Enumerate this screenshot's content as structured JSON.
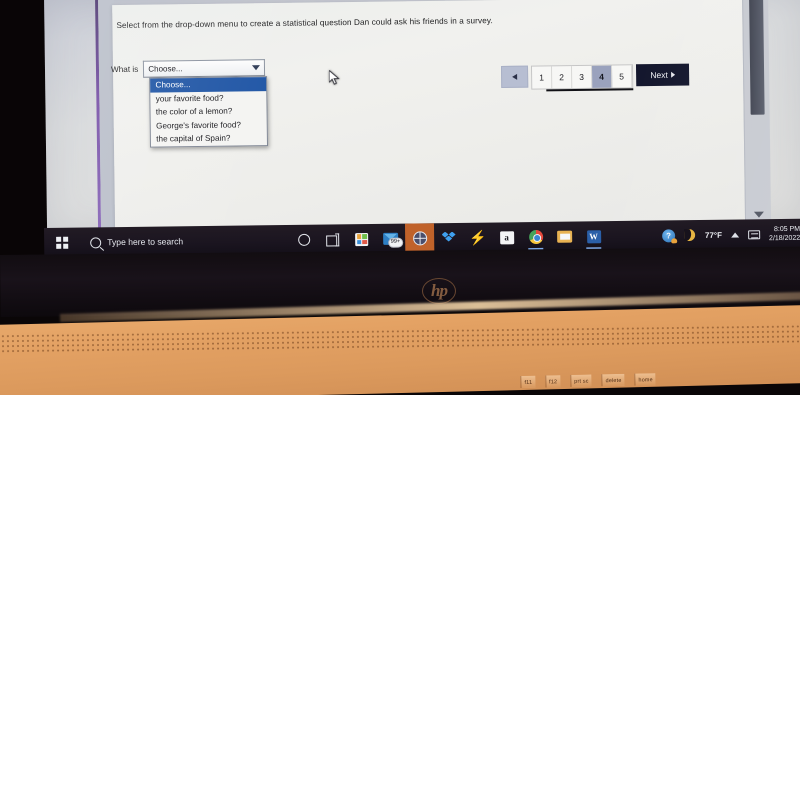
{
  "photo": {
    "device_brand_logo": "hp",
    "keyboard_keys": [
      "f11",
      "f12",
      "prt sc",
      "delete",
      "home"
    ]
  },
  "quiz": {
    "prompt": "Select from the drop-down menu to create a statistical question Dan could ask his friends in a survey.",
    "question_label": "What is",
    "dropdown": {
      "name": "statistical-question-select",
      "selected_value": "Choose...",
      "placeholder": "Choose...",
      "expanded": true,
      "highlighted_index": 0,
      "options": [
        "Choose...",
        "your favorite food?",
        "the color of a lemon?",
        "George's favorite food?",
        "the capital of Spain?"
      ]
    },
    "pagination": {
      "prev_label": "◂",
      "pages": [
        "1",
        "2",
        "3",
        "4",
        "5"
      ],
      "current_page": "4",
      "next_label": "Next",
      "next_arrow": "▸"
    },
    "colors": {
      "accent_purple": "#6b3fa0",
      "option_highlight_blue": "#1f55a5",
      "active_page_blue_gray": "#9aa2bd",
      "next_button_navy": "#10132a"
    }
  },
  "taskbar": {
    "start_icon": "windows-logo-icon",
    "search": {
      "icon": "search-icon",
      "placeholder": "Type here to search",
      "value": "Type here to search"
    },
    "pinned_icons": [
      {
        "name": "cortana-icon",
        "label": "Cortana"
      },
      {
        "name": "task-view-icon",
        "label": "Task View"
      },
      {
        "name": "microsoft-store-icon",
        "label": "Microsoft Store"
      },
      {
        "name": "mail-icon",
        "label": "Mail",
        "badge": "99+"
      },
      {
        "name": "globe-icon",
        "label": "Browser",
        "active": true
      },
      {
        "name": "dropbox-icon",
        "label": "Dropbox"
      },
      {
        "name": "lightning-bolt-icon",
        "label": "Bolt"
      },
      {
        "name": "amazon-icon",
        "label": "Amazon"
      },
      {
        "name": "chrome-icon",
        "label": "Google Chrome"
      },
      {
        "name": "file-explorer-icon",
        "label": "File Explorer"
      },
      {
        "name": "word-icon",
        "label": "Microsoft Word",
        "running": true
      }
    ],
    "tray": {
      "weather_icon": "weather-icon",
      "moon_icon": "moon-icon",
      "temperature": "77°F",
      "overflow_icon": "chevron-up-icon",
      "network_icon": "network-icon",
      "time": "8:05 PM",
      "date": "2/18/2022"
    },
    "colors": {
      "taskbar_bg": "#1b1520",
      "active_highlight_orange": "#c0622a"
    }
  },
  "scrollbar": {
    "name": "page-scrollbar",
    "thumb_position": "top",
    "down_arrow_icon": "chevron-down-icon"
  }
}
